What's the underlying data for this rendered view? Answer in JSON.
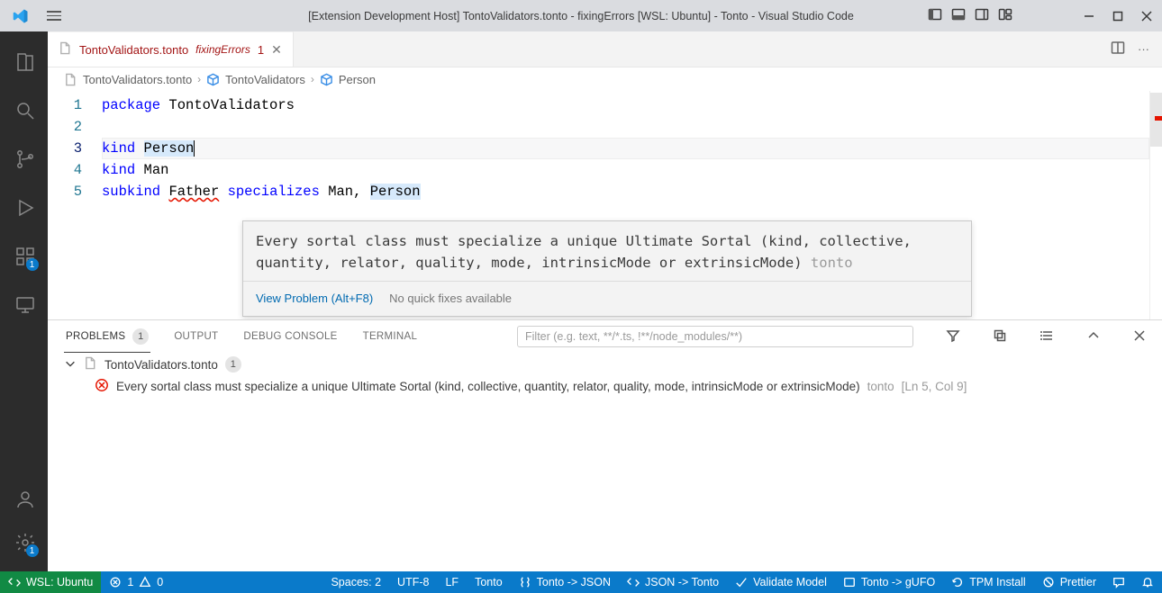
{
  "titlebar": {
    "title": "[Extension Development Host] TontoValidators.tonto - fixingErrors [WSL: Ubuntu] - Tonto - Visual Studio Code"
  },
  "activitybar": {
    "extensions_badge": "1",
    "settings_badge": "1"
  },
  "tab": {
    "filename": "TontoValidators.tonto",
    "folder": "fixingErrors",
    "error_count": "1"
  },
  "breadcrumb": {
    "file": "TontoValidators.tonto",
    "package": "TontoValidators",
    "symbol": "Person"
  },
  "editor": {
    "lines": [
      "1",
      "2",
      "3",
      "4",
      "5"
    ],
    "l1_kw": "package",
    "l1_name": " TontoValidators",
    "l3_kw": "kind",
    "l3_name": "Person",
    "l4_kw": "kind",
    "l4_name": " Man",
    "l5_kw1": "subkind",
    "l5_name": "Father",
    "l5_kw2": "specializes",
    "l5_rest1": " Man, ",
    "l5_rest2": "Person"
  },
  "hover": {
    "message": "Every sortal class must specialize a unique Ultimate Sortal (kind, collective, quantity, relator, quality, mode, intrinsicMode or extrinsicMode)",
    "source": " tonto",
    "view_problem": "View Problem (Alt+F8)",
    "no_fixes": "No quick fixes available"
  },
  "panel": {
    "tabs": {
      "problems": "PROBLEMS",
      "output": "OUTPUT",
      "debug": "DEBUG CONSOLE",
      "terminal": "TERMINAL"
    },
    "problems_count": "1",
    "filter_placeholder": "Filter (e.g. text, **/*.ts, !**/node_modules/**)",
    "file": "TontoValidators.tonto",
    "file_count": "1",
    "error_msg": "Every sortal class must specialize a unique Ultimate Sortal (kind, collective, quantity, relator, quality, mode, intrinsicMode or extrinsicMode)",
    "error_src": "tonto",
    "error_loc": "[Ln 5, Col 9]"
  },
  "statusbar": {
    "remote": "WSL: Ubuntu",
    "errors": "1",
    "warnings": "0",
    "spaces": "Spaces: 2",
    "encoding": "UTF-8",
    "eol": "LF",
    "lang": "Tonto",
    "tonto_json": "Tonto -> JSON",
    "json_tonto": "JSON -> Tonto",
    "validate": "Validate Model",
    "tonto_gufo": "Tonto -> gUFO",
    "tpm": "TPM Install",
    "prettier": "Prettier"
  }
}
